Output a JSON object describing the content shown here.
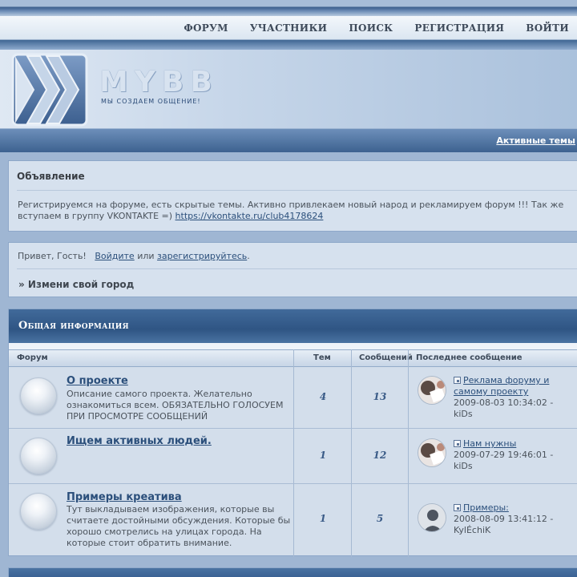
{
  "navbar": {
    "items": [
      "ФОРУМ",
      "УЧАСТНИКИ",
      "ПОИСК",
      "РЕГИСТРАЦИЯ",
      "ВОЙТИ"
    ]
  },
  "header": {
    "logo_text": "MYBB",
    "slogan": "мы создаем общение!"
  },
  "subbar": {
    "active_topics": "Активные темы"
  },
  "announcement": {
    "title": "Объявление",
    "text": "Регистрируемся на форуме, есть скрытые темы. Активно привлекаем новый народ и рекламируем форум !!! Так же вступаем в группу VKONTAKTE =) ",
    "link": "https://vkontakte.ru/club4178624"
  },
  "welcome": {
    "greeting": "Привет, Гость!",
    "login_link": "Войдите",
    "or": "или",
    "register_link": "зарегистрируйтесь",
    "city": "» Измени свой город"
  },
  "category": {
    "title": "Общая информация",
    "columns": {
      "forum": "Форум",
      "topics": "Тем",
      "posts": "Сообщений",
      "last_post": "Последнее сообщение"
    },
    "forums": [
      {
        "title": "О проекте",
        "description": "Описание самого проекта. Желательно ознакомиться всем. ОБЯЗАТЕЛЬНО ГОЛОСУЕМ ПРИ ПРОСМОТРЕ СООБЩЕНИЙ",
        "topics": "4",
        "posts": "13",
        "last_title": "Реклама форуму и самому проекту",
        "last_date": "2009-08-03 10:34:02 -",
        "last_user": "kiDs"
      },
      {
        "title": "Ищем активных людей.",
        "description": "",
        "topics": "1",
        "posts": "12",
        "last_title": "Нам нужны",
        "last_date": "2009-07-29 19:46:01 -",
        "last_user": "kiDs"
      },
      {
        "title": "Примеры креатива",
        "description": "Тут выкладываем изображения, которые вы считаете достойными обсуждения. Которые бы хорошо смотрелись на улицах города. На которые стоит обратить внимание.",
        "topics": "1",
        "posts": "5",
        "last_title": "Примеры:",
        "last_date": "2008-08-09 13:41:12 -",
        "last_user": "KylÉchiK"
      }
    ]
  }
}
